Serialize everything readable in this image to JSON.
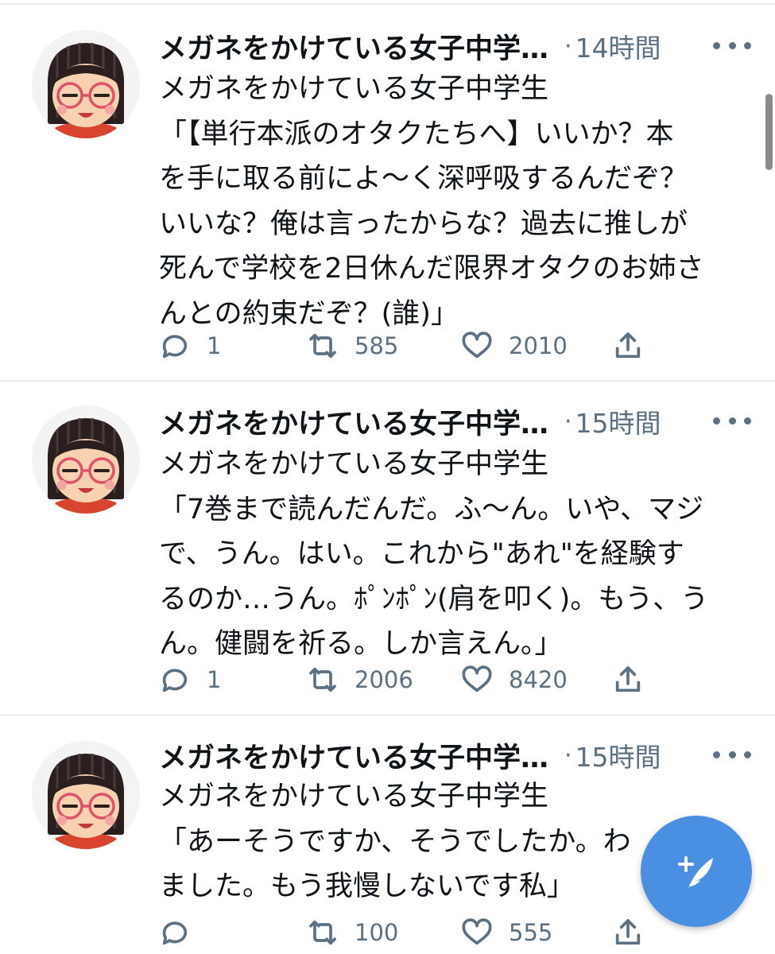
{
  "colors": {
    "accent": "#4a90e2",
    "secondary_text": "#5b7083",
    "divider": "#e6ecf0"
  },
  "tweets": [
    {
      "author_display": "メガネをかけている女子中学…",
      "separator": "·",
      "time": "14時間",
      "text": "メガネをかけている女子中学生\n「【単行本派のオタクたちへ】いいか？本\nを手に取る前によ〜く深呼吸するんだぞ？\nいいな？俺は言ったからな？過去に推しが\n死んで学校を2日休んだ限界オタクのお姉さ\nんとの約束だぞ？(誰)」",
      "replies": "1",
      "retweets": "585",
      "likes": "2010"
    },
    {
      "author_display": "メガネをかけている女子中学…",
      "separator": "·",
      "time": "15時間",
      "text": "メガネをかけている女子中学生\n「7巻まで読んだんだ。ふ〜ん。いや、マジ\nで、うん。はい。これから\"あれ\"を経験す\nるのか…うん。ﾎﾟﾝﾎﾟﾝ(肩を叩く)。もう、う\nん。健闘を祈る。しか言えん。」",
      "replies": "1",
      "retweets": "2006",
      "likes": "8420"
    },
    {
      "author_display": "メガネをかけている女子中学…",
      "separator": "·",
      "time": "15時間",
      "text": "メガネをかけている女子中学生\n「あーそうですか、そうでしたか。わ\nました。もう我慢しないです私」",
      "replies": "",
      "retweets": "100",
      "likes": "555"
    }
  ],
  "icons": {
    "reply": "reply-icon",
    "retweet": "retweet-icon",
    "like": "heart-icon",
    "share": "share-icon",
    "more": "more-icon",
    "compose": "compose-tweet-icon"
  }
}
